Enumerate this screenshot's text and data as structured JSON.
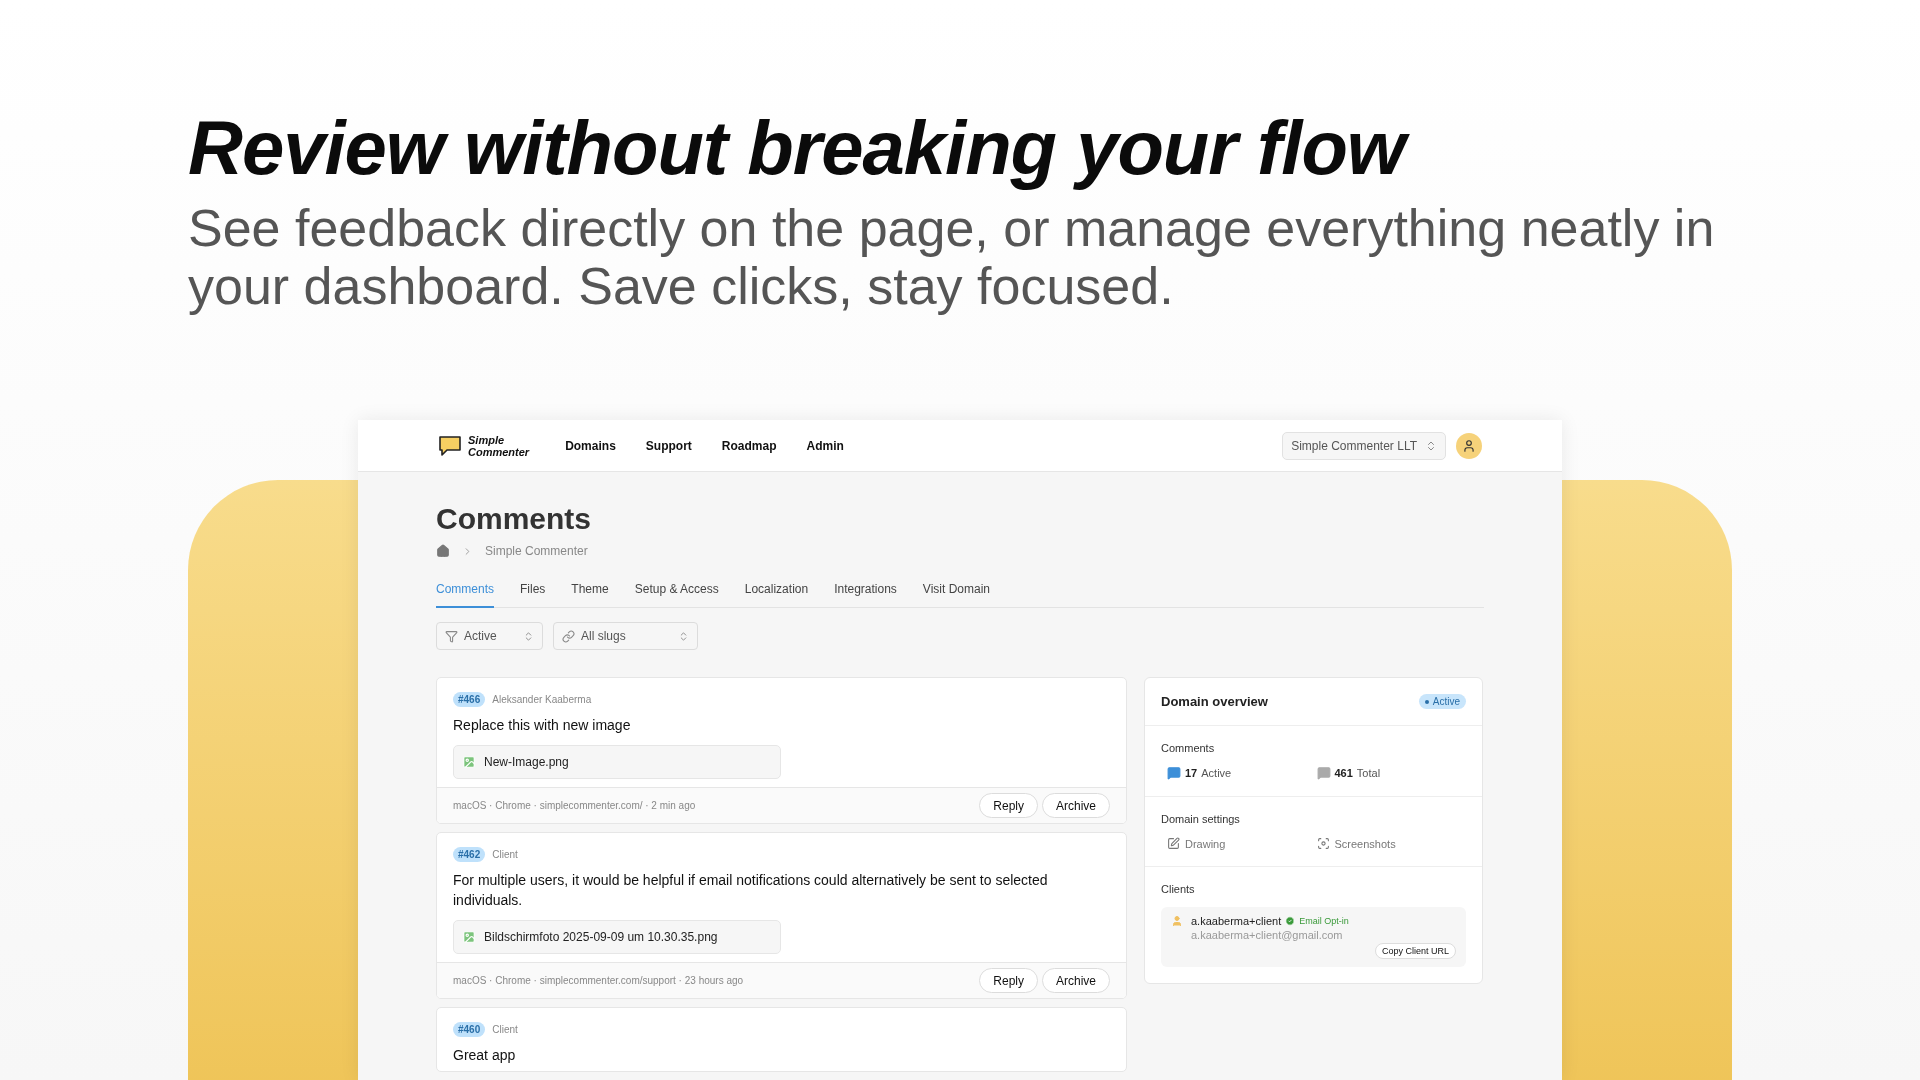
{
  "hero": {
    "headline": "Review without breaking your flow",
    "subtitle": "See feedback directly on the page, or manage everything neatly in your dashboard. Save clicks, stay focused."
  },
  "app": {
    "logo": {
      "line1": "Simple",
      "line2": "Commenter"
    },
    "nav": [
      "Domains",
      "Support",
      "Roadmap",
      "Admin"
    ],
    "workspace": "Simple Commenter LLT",
    "page_title": "Comments",
    "breadcrumb": [
      "Simple Commenter"
    ],
    "tabs": [
      {
        "label": "Comments",
        "selected": true
      },
      {
        "label": "Files",
        "selected": false
      },
      {
        "label": "Theme",
        "selected": false
      },
      {
        "label": "Setup & Access",
        "selected": false
      },
      {
        "label": "Localization",
        "selected": false
      },
      {
        "label": "Integrations",
        "selected": false
      },
      {
        "label": "Visit Domain",
        "selected": false
      }
    ],
    "filters": [
      {
        "kind": "status",
        "value": "Active"
      },
      {
        "kind": "slug",
        "value": "All slugs"
      }
    ],
    "comments": [
      {
        "number": "#466",
        "author": "Aleksander Kaaberma",
        "text": "Replace this with new image",
        "attachment": "New-Image.png",
        "meta": "macOS · Chrome · simplecommenter.com/ · 2 min ago",
        "actions": [
          "Reply",
          "Archive"
        ]
      },
      {
        "number": "#462",
        "author": "Client",
        "text": "For multiple users, it would be helpful if email notifications could alternatively be sent to selected individuals.",
        "attachment": "Bildschirmfoto 2025-09-09 um 10.30.35.png",
        "meta": "macOS · Chrome · simplecommenter.com/support · 23 hours ago",
        "actions": [
          "Reply",
          "Archive"
        ]
      },
      {
        "number": "#460",
        "author": "Client",
        "text": "Great app"
      }
    ],
    "overview": {
      "title": "Domain overview",
      "status": "Active",
      "comments_heading": "Comments",
      "stats": [
        {
          "kind": "active",
          "count": "17",
          "label": "Active"
        },
        {
          "kind": "total",
          "count": "461",
          "label": "Total"
        }
      ],
      "settings_heading": "Domain settings",
      "settings": [
        {
          "kind": "drawing",
          "label": "Drawing"
        },
        {
          "kind": "screenshots",
          "label": "Screenshots"
        }
      ],
      "clients_heading": "Clients",
      "clients": [
        {
          "name": "a.kaaberma+client",
          "badge": "Email Opt-in",
          "email": "a.kaaberma+client@gmail.com",
          "action": "Copy Client URL"
        }
      ]
    }
  }
}
